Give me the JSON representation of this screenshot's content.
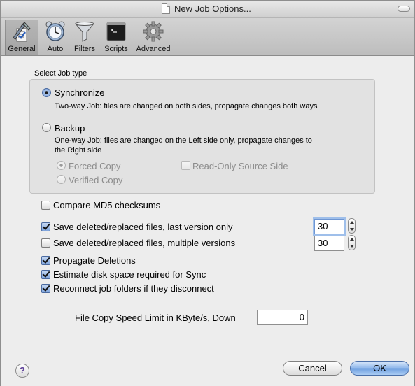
{
  "window": {
    "title": "New Job Options..."
  },
  "toolbar": {
    "items": [
      {
        "label": "General",
        "icon": "general-icon",
        "selected": true
      },
      {
        "label": "Auto",
        "icon": "alarm-clock-icon",
        "selected": false
      },
      {
        "label": "Filters",
        "icon": "funnel-icon",
        "selected": false
      },
      {
        "label": "Scripts",
        "icon": "terminal-icon",
        "selected": false
      },
      {
        "label": "Advanced",
        "icon": "gear-icon",
        "selected": false
      }
    ]
  },
  "job_type": {
    "heading": "Select Job type",
    "synchronize": {
      "label": "Synchronize",
      "description": "Two-way Job: files are changed on both sides, propagate changes both ways",
      "selected": true
    },
    "backup": {
      "label": "Backup",
      "description_line1": "One-way Job: files are changed on the Left side only, propagate changes to",
      "description_line2": "the Right side",
      "selected": false
    },
    "forced_copy": {
      "label": "Forced Copy",
      "selected": true,
      "enabled": false
    },
    "verified_copy": {
      "label": "Verified Copy",
      "selected": false,
      "enabled": false
    },
    "read_only_source": {
      "label": "Read-Only Source Side",
      "checked": false,
      "enabled": false
    }
  },
  "options": {
    "compare_md5": {
      "label": "Compare MD5 checksums",
      "checked": false
    },
    "save_last_version": {
      "label": "Save deleted/replaced files, last version only",
      "checked": true,
      "value": "30"
    },
    "save_multiple_versions": {
      "label": "Save deleted/replaced files, multiple versions",
      "checked": false,
      "value": "30"
    },
    "propagate_deletions": {
      "label": "Propagate Deletions",
      "checked": true
    },
    "estimate_disk_space": {
      "label": "Estimate disk space required for Sync",
      "checked": true
    },
    "reconnect_folders": {
      "label": "Reconnect job folders if they disconnect",
      "checked": true
    }
  },
  "speed_limit": {
    "label": "File Copy Speed Limit in KByte/s, Down",
    "value": "0"
  },
  "buttons": {
    "cancel": "Cancel",
    "ok": "OK",
    "help": "?"
  }
}
